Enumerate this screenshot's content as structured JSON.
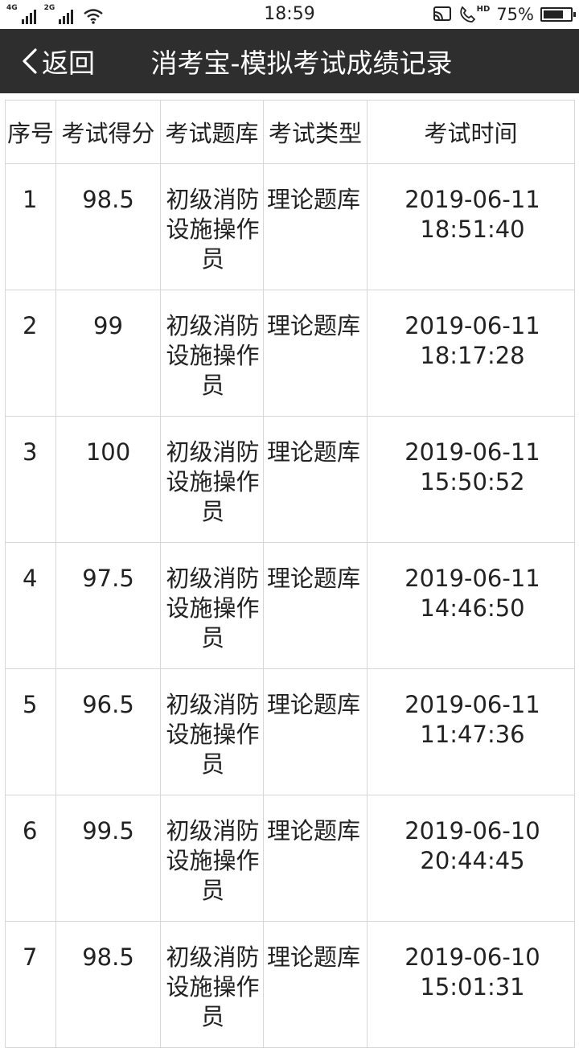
{
  "status_bar": {
    "net_1": "4G",
    "net_2": "2G",
    "time": "18:59",
    "hd_label": "HD",
    "battery_percent": "75%",
    "battery_level": 0.75
  },
  "nav": {
    "back_label": "返回",
    "title": "消考宝-模拟考试成绩记录"
  },
  "table": {
    "headers": [
      "序号",
      "考试得分",
      "考试题库",
      "考试类型",
      "考试时间"
    ],
    "rows": [
      {
        "index": "1",
        "score": "98.5",
        "bank": "初级消防设施操作员",
        "type": "理论题库",
        "date": "2019-06-11",
        "time": "18:51:40"
      },
      {
        "index": "2",
        "score": "99",
        "bank": "初级消防设施操作员",
        "type": "理论题库",
        "date": "2019-06-11",
        "time": "18:17:28"
      },
      {
        "index": "3",
        "score": "100",
        "bank": "初级消防设施操作员",
        "type": "理论题库",
        "date": "2019-06-11",
        "time": "15:50:52"
      },
      {
        "index": "4",
        "score": "97.5",
        "bank": "初级消防设施操作员",
        "type": "理论题库",
        "date": "2019-06-11",
        "time": "14:46:50"
      },
      {
        "index": "5",
        "score": "96.5",
        "bank": "初级消防设施操作员",
        "type": "理论题库",
        "date": "2019-06-11",
        "time": "11:47:36"
      },
      {
        "index": "6",
        "score": "99.5",
        "bank": "初级消防设施操作员",
        "type": "理论题库",
        "date": "2019-06-10",
        "time": "20:44:45"
      },
      {
        "index": "7",
        "score": "98.5",
        "bank": "初级消防设施操作员",
        "type": "理论题库",
        "date": "2019-06-10",
        "time": "15:01:31"
      }
    ]
  }
}
